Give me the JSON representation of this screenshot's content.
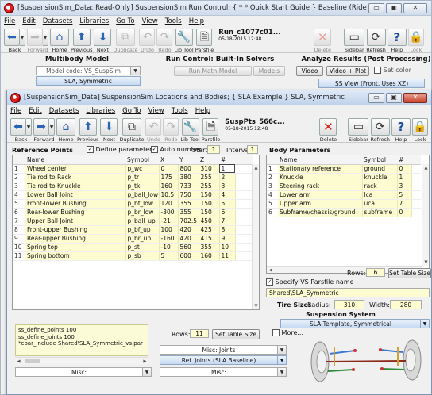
{
  "back_window": {
    "title": "[SuspensionSim_Data: Read-Only] SuspensionSim Run Control; { * * Quick Start Guide } Baseline (Ride Test)",
    "menu": [
      "File",
      "Edit",
      "Datasets",
      "Libraries",
      "Go To",
      "View",
      "Tools",
      "Help"
    ],
    "toolbar": {
      "back": "Back",
      "forward": "Forward",
      "home": "Home",
      "previous": "Previous",
      "next": "Next",
      "duplicate": "Duplicate",
      "undo": "Undo",
      "redo": "Redo",
      "lib_tool": "Lib Tool",
      "parsfile": "Parsfile",
      "delete": "Delete",
      "sidebar": "Sidebar",
      "refresh": "Refresh",
      "help": "Help",
      "lock": "Lock"
    },
    "run": {
      "name": "Run_c1077c01...",
      "date": "05-18-2015 12:48"
    },
    "multibody": {
      "heading": "Multibody Model",
      "model_code": "Model code: VS_SuspSim",
      "selected": "SLA, Symmetric"
    },
    "run_control": {
      "heading": "Run Control: Built-In Solvers",
      "run_button": "Run Math Model",
      "models_button": "Models"
    },
    "analyze": {
      "heading": "Analyze Results (Post Processing)",
      "video_button": "Video",
      "video_plot_button": "Video + Plot",
      "set_color": "Set color",
      "view_selection": "SS View (Front, Uses XZ)"
    }
  },
  "front_window": {
    "title": "[SuspensionSim_Data] SuspensionSim Locations and Bodies; { SLA Example } SLA, Symmetric",
    "menu": [
      "File",
      "Edit",
      "Datasets",
      "Libraries",
      "Go To",
      "View",
      "Tools",
      "Help"
    ],
    "toolbar": {
      "back": "Back",
      "forward": "Forward",
      "home": "Home",
      "previous": "Previous",
      "next": "Next",
      "duplicate": "Duplicate",
      "undo": "Undo",
      "redo": "Redo",
      "lib_tool": "Lib Tool",
      "parsfile": "Parsfile",
      "delete": "Delete",
      "sidebar": "Sidebar",
      "refresh": "Refresh",
      "help": "Help",
      "lock": "Lock"
    },
    "dataset": {
      "name": "SuspPts_566c...",
      "date": "05-18-2015 12:48"
    },
    "ref_points": {
      "heading": "Reference Points",
      "define_parameters": "Define parameters",
      "auto_number": "Auto number",
      "start_label": "Start:",
      "start_value": "1",
      "interval_label": "Interval:",
      "interval_value": "1",
      "columns": [
        "Name",
        "Symbol",
        "X",
        "Y",
        "Z",
        "#"
      ],
      "rows": [
        [
          "1",
          "Wheel center",
          "p_wc",
          "0",
          "800",
          "310",
          "1"
        ],
        [
          "2",
          "Tie rod to Rack",
          "p_tr",
          "175",
          "380",
          "255",
          "2"
        ],
        [
          "3",
          "Tie rod to Knuckle",
          "p_tk",
          "160",
          "733",
          "255",
          "3"
        ],
        [
          "4",
          "Lower Ball Joint",
          "p_ball_low",
          "10.5",
          "750",
          "150",
          "4"
        ],
        [
          "5",
          "Front-lower Bushing",
          "p_bf_low",
          "120",
          "355",
          "150",
          "5"
        ],
        [
          "6",
          "Rear-lower Bushing",
          "p_br_low",
          "-300",
          "355",
          "150",
          "6"
        ],
        [
          "7",
          "Upper Ball Joint",
          "p_ball_up",
          "-21",
          "702.5",
          "450",
          "7"
        ],
        [
          "8",
          "Front-upper Bushing",
          "p_bf_up",
          "100",
          "420",
          "425",
          "8"
        ],
        [
          "9",
          "Rear-upper Bushing",
          "p_br_up",
          "-160",
          "420",
          "415",
          "9"
        ],
        [
          "10",
          "Spring top",
          "p_st",
          "-10",
          "560",
          "355",
          "10"
        ],
        [
          "11",
          "Spring bottom",
          "p_sb",
          "5",
          "600",
          "160",
          "11"
        ]
      ],
      "rows_label": "Rows:",
      "rows_value": "11",
      "set_table_size": "Set Table Size"
    },
    "body_params": {
      "heading": "Body Parameters",
      "columns": [
        "Name",
        "Symbol",
        "#"
      ],
      "rows": [
        [
          "1",
          "Stationary reference",
          "ground",
          "0"
        ],
        [
          "2",
          "Knuckle",
          "knuckle",
          "1"
        ],
        [
          "3",
          "Steering rack",
          "rack",
          "3"
        ],
        [
          "4",
          "Lower arm",
          "lca",
          "5"
        ],
        [
          "5",
          "Upper arm",
          "uca",
          "7"
        ],
        [
          "6",
          "Subframe/chassis/ground",
          "subframe",
          "0"
        ]
      ],
      "rows_label": "Rows:",
      "rows_value": "6",
      "set_table_size": "Set Table Size"
    },
    "parsfile": {
      "specify_label": "Specify VS Parsfile name",
      "value": "Shared\\SLA_Symmetric"
    },
    "tire": {
      "label": "Tire Size:",
      "radius_label": "Radius:",
      "radius_value": "310",
      "width_label": "Width:",
      "width_value": "280"
    },
    "suspension": {
      "heading": "Suspension System",
      "selected": "SLA Template, Symmetrical"
    },
    "notes": "ss_define_points 100\nss_define_joints 100\n*cpar_include Shared\\SLA_Symmetric_vs.par",
    "more_label": "More...",
    "misc_joints": "Misc: Joints",
    "ref_joints": "Ref. Joints (SLA Baseline)",
    "misc_left": "Misc:",
    "misc_mid": "Misc:"
  }
}
